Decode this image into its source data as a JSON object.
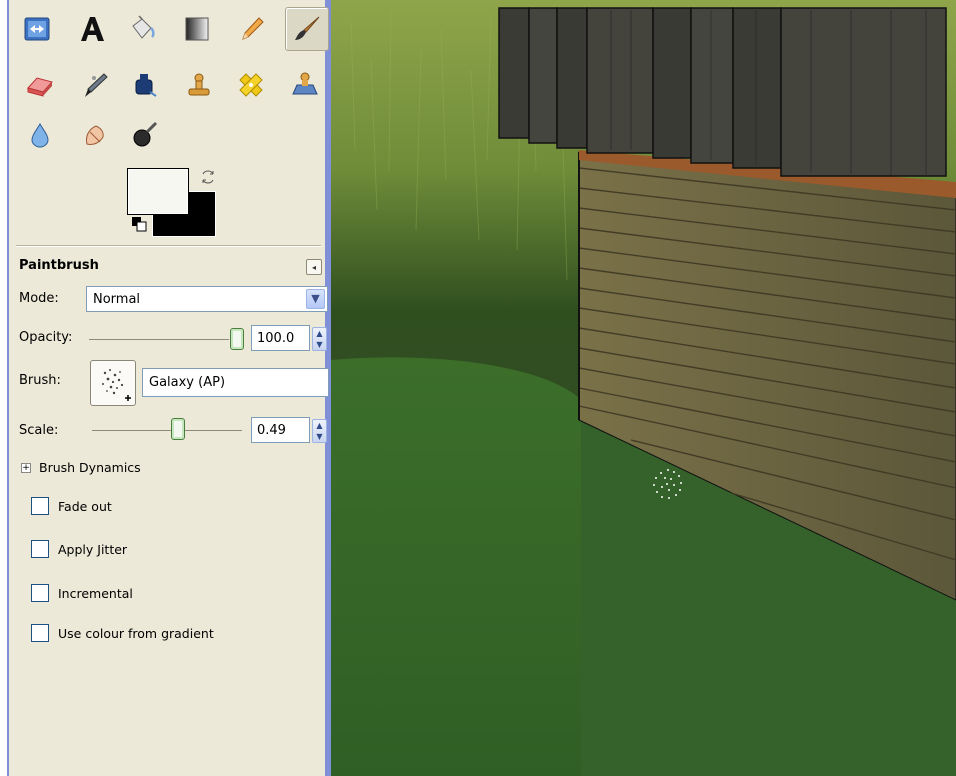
{
  "tools": {
    "row1": [
      "move-tool-icon",
      "text-tool-icon",
      "bucket-fill-icon",
      "blend-tool-icon",
      "pencil-icon",
      "paintbrush-icon"
    ],
    "row2": [
      "eraser-icon",
      "airbrush-icon",
      "ink-icon",
      "clone-icon",
      "heal-icon",
      "perspective-clone-icon"
    ],
    "row3": [
      "blur-sharpen-icon",
      "smudge-icon",
      "dodge-burn-icon"
    ],
    "active": "paintbrush-icon"
  },
  "colors": {
    "foreground": "#f7f7f2",
    "background": "#000000"
  },
  "options": {
    "title": "Paintbrush",
    "mode_label": "Mode:",
    "mode_value": "Normal",
    "opacity_label": "Opacity:",
    "opacity_value": "100.0",
    "opacity_fraction": 1.0,
    "brush_label": "Brush:",
    "brush_value": "Galaxy (AP)",
    "scale_label": "Scale:",
    "scale_value": "0.49",
    "brush_dynamics": "Brush Dynamics",
    "checkboxes": [
      {
        "label": "Fade out",
        "checked": false
      },
      {
        "label": "Apply Jitter",
        "checked": false
      },
      {
        "label": "Incremental",
        "checked": false
      },
      {
        "label": "Use colour from gradient",
        "checked": false
      }
    ]
  }
}
